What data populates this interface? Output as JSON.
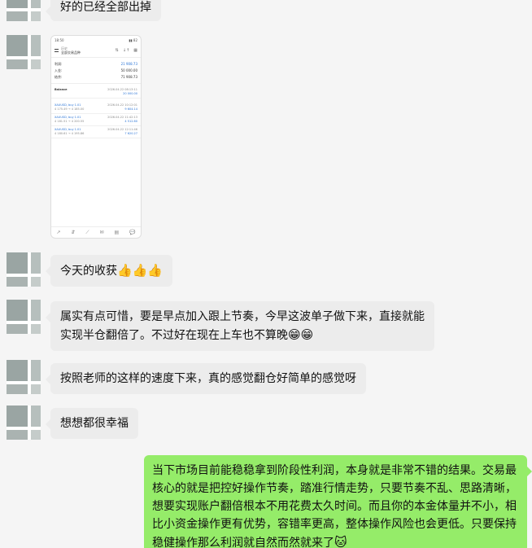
{
  "messages": {
    "m0": "好的已经全部出掉",
    "m2_text": "今天的收获",
    "m2_emoji": "👍👍👍",
    "m3_text": "属实有点可惜，要是早点加入跟上节奏，今早这波单子做下来，直接就能实现半仓翻倍了。不过好在现在上车也不算晚",
    "m3_emoji": "😁😁",
    "m4": "按照老师的这样的速度下来，真的感觉翻仓好简单的感觉呀",
    "m5": "想想都很幸福",
    "m6_text": "当下市场目前能稳稳拿到阶段性利润，本身就是非常不错的结果。交易最核心的就是把控好操作节奏，踏准行情走势，只要节奏不乱、思路清晰，想要实现账户翻倍根本不用花费太久时间。而且你的本金体量并不小，相比小资金操作更有优势，容错率更高，整体操作风险也会更低。只要保持稳健操作那么利润就自然而然就来了",
    "m6_emoji": "🐱"
  },
  "screenshot": {
    "status_time": "18:50",
    "status_right": "▮▮ 82",
    "header_sub": "历史",
    "header_title": "全部交易品种",
    "icons": [
      "⇅",
      "↓↑",
      "▦"
    ],
    "summary": [
      {
        "label": "利润:",
        "value": "21 908.73",
        "color": "blue"
      },
      {
        "label": "入金:",
        "value": "50 000.00",
        "color": "normal"
      },
      {
        "label": "结余:",
        "value": "71 908.73",
        "color": "normal"
      }
    ],
    "balance_label": "Balance",
    "balance_date": "2026.04.22 08:13:11",
    "balance_value": "20 000.00",
    "entries": [
      {
        "sym": "XAUUSD, buy 1.01",
        "date": "2026.04.22 10:12:01",
        "price": "4 175.49 → 4 185.00",
        "pl": "9 604.14"
      },
      {
        "sym": "XAUUSD, buy 1.01",
        "date": "2026.04.22 11:42:13",
        "price": "4 181.51 → 4 200.55",
        "pl": "4 512.60"
      },
      {
        "sym": "XAUUSD, buy 1.01",
        "date": "2026.04.22 12:11:46",
        "price": "4 180.61 → 4 195.86",
        "pl": "7 620.27"
      }
    ],
    "bottom_icons": [
      "↗",
      "⇵",
      "⟋",
      "✉",
      "▤",
      "💬"
    ]
  }
}
